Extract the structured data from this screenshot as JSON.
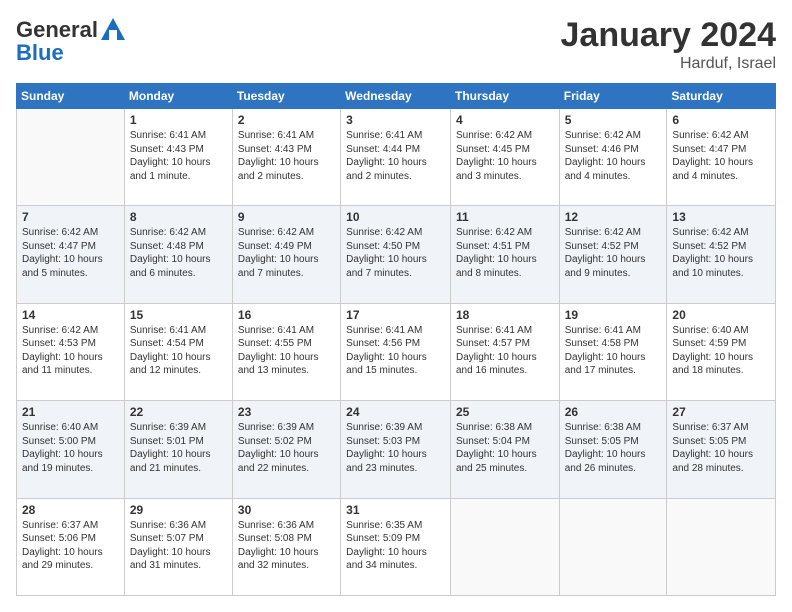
{
  "header": {
    "logo_line1": "General",
    "logo_line2": "Blue",
    "month": "January 2024",
    "location": "Harduf, Israel"
  },
  "weekdays": [
    "Sunday",
    "Monday",
    "Tuesday",
    "Wednesday",
    "Thursday",
    "Friday",
    "Saturday"
  ],
  "weeks": [
    [
      {
        "day": "",
        "info": ""
      },
      {
        "day": "1",
        "info": "Sunrise: 6:41 AM\nSunset: 4:43 PM\nDaylight: 10 hours\nand 1 minute."
      },
      {
        "day": "2",
        "info": "Sunrise: 6:41 AM\nSunset: 4:43 PM\nDaylight: 10 hours\nand 2 minutes."
      },
      {
        "day": "3",
        "info": "Sunrise: 6:41 AM\nSunset: 4:44 PM\nDaylight: 10 hours\nand 2 minutes."
      },
      {
        "day": "4",
        "info": "Sunrise: 6:42 AM\nSunset: 4:45 PM\nDaylight: 10 hours\nand 3 minutes."
      },
      {
        "day": "5",
        "info": "Sunrise: 6:42 AM\nSunset: 4:46 PM\nDaylight: 10 hours\nand 4 minutes."
      },
      {
        "day": "6",
        "info": "Sunrise: 6:42 AM\nSunset: 4:47 PM\nDaylight: 10 hours\nand 4 minutes."
      }
    ],
    [
      {
        "day": "7",
        "info": "Sunrise: 6:42 AM\nSunset: 4:47 PM\nDaylight: 10 hours\nand 5 minutes."
      },
      {
        "day": "8",
        "info": "Sunrise: 6:42 AM\nSunset: 4:48 PM\nDaylight: 10 hours\nand 6 minutes."
      },
      {
        "day": "9",
        "info": "Sunrise: 6:42 AM\nSunset: 4:49 PM\nDaylight: 10 hours\nand 7 minutes."
      },
      {
        "day": "10",
        "info": "Sunrise: 6:42 AM\nSunset: 4:50 PM\nDaylight: 10 hours\nand 7 minutes."
      },
      {
        "day": "11",
        "info": "Sunrise: 6:42 AM\nSunset: 4:51 PM\nDaylight: 10 hours\nand 8 minutes."
      },
      {
        "day": "12",
        "info": "Sunrise: 6:42 AM\nSunset: 4:52 PM\nDaylight: 10 hours\nand 9 minutes."
      },
      {
        "day": "13",
        "info": "Sunrise: 6:42 AM\nSunset: 4:52 PM\nDaylight: 10 hours\nand 10 minutes."
      }
    ],
    [
      {
        "day": "14",
        "info": "Sunrise: 6:42 AM\nSunset: 4:53 PM\nDaylight: 10 hours\nand 11 minutes."
      },
      {
        "day": "15",
        "info": "Sunrise: 6:41 AM\nSunset: 4:54 PM\nDaylight: 10 hours\nand 12 minutes."
      },
      {
        "day": "16",
        "info": "Sunrise: 6:41 AM\nSunset: 4:55 PM\nDaylight: 10 hours\nand 13 minutes."
      },
      {
        "day": "17",
        "info": "Sunrise: 6:41 AM\nSunset: 4:56 PM\nDaylight: 10 hours\nand 15 minutes."
      },
      {
        "day": "18",
        "info": "Sunrise: 6:41 AM\nSunset: 4:57 PM\nDaylight: 10 hours\nand 16 minutes."
      },
      {
        "day": "19",
        "info": "Sunrise: 6:41 AM\nSunset: 4:58 PM\nDaylight: 10 hours\nand 17 minutes."
      },
      {
        "day": "20",
        "info": "Sunrise: 6:40 AM\nSunset: 4:59 PM\nDaylight: 10 hours\nand 18 minutes."
      }
    ],
    [
      {
        "day": "21",
        "info": "Sunrise: 6:40 AM\nSunset: 5:00 PM\nDaylight: 10 hours\nand 19 minutes."
      },
      {
        "day": "22",
        "info": "Sunrise: 6:39 AM\nSunset: 5:01 PM\nDaylight: 10 hours\nand 21 minutes."
      },
      {
        "day": "23",
        "info": "Sunrise: 6:39 AM\nSunset: 5:02 PM\nDaylight: 10 hours\nand 22 minutes."
      },
      {
        "day": "24",
        "info": "Sunrise: 6:39 AM\nSunset: 5:03 PM\nDaylight: 10 hours\nand 23 minutes."
      },
      {
        "day": "25",
        "info": "Sunrise: 6:38 AM\nSunset: 5:04 PM\nDaylight: 10 hours\nand 25 minutes."
      },
      {
        "day": "26",
        "info": "Sunrise: 6:38 AM\nSunset: 5:05 PM\nDaylight: 10 hours\nand 26 minutes."
      },
      {
        "day": "27",
        "info": "Sunrise: 6:37 AM\nSunset: 5:05 PM\nDaylight: 10 hours\nand 28 minutes."
      }
    ],
    [
      {
        "day": "28",
        "info": "Sunrise: 6:37 AM\nSunset: 5:06 PM\nDaylight: 10 hours\nand 29 minutes."
      },
      {
        "day": "29",
        "info": "Sunrise: 6:36 AM\nSunset: 5:07 PM\nDaylight: 10 hours\nand 31 minutes."
      },
      {
        "day": "30",
        "info": "Sunrise: 6:36 AM\nSunset: 5:08 PM\nDaylight: 10 hours\nand 32 minutes."
      },
      {
        "day": "31",
        "info": "Sunrise: 6:35 AM\nSunset: 5:09 PM\nDaylight: 10 hours\nand 34 minutes."
      },
      {
        "day": "",
        "info": ""
      },
      {
        "day": "",
        "info": ""
      },
      {
        "day": "",
        "info": ""
      }
    ]
  ]
}
